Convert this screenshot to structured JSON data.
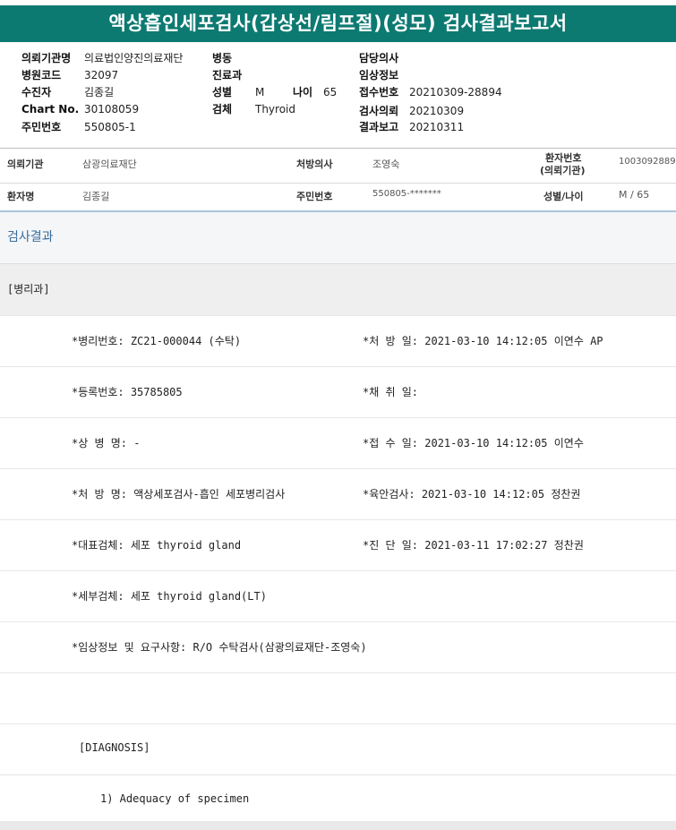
{
  "title": "액상흡인세포검사(갑상선/림프절)(성모) 검사결과보고서",
  "info": {
    "col1": [
      {
        "key": "의뢰기관명",
        "value": "의료법인양진의료재단"
      },
      {
        "key": "병원코드",
        "value": "32097"
      },
      {
        "key": "수진자",
        "value": "김종길"
      },
      {
        "key": "Chart No.",
        "value": "30108059"
      },
      {
        "key": "주민번호",
        "value": "550805-1"
      }
    ],
    "col2": [
      {
        "key": "병동",
        "value": ""
      },
      {
        "key": "진료과",
        "value": ""
      },
      {
        "key": "성별",
        "value": "M"
      },
      {
        "key": "검체",
        "value": "Thyroid"
      }
    ],
    "age": {
      "key": "나이",
      "value": "65"
    },
    "col3": [
      {
        "key": "담당의사",
        "value": ""
      },
      {
        "key": "임상정보",
        "value": ""
      },
      {
        "key": "접수번호",
        "value": "20210309-28894"
      },
      {
        "key": "검사의뢰",
        "value": "20210309"
      },
      {
        "key": "결과보고",
        "value": "20210311"
      }
    ]
  },
  "header": {
    "row1": {
      "institution_label": "의뢰기관",
      "institution_value": "삼광의료재단",
      "doctor_label": "처방의사",
      "doctor_value": "조영숙",
      "patient_no_label_1": "환자번호",
      "patient_no_label_2": "(의뢰기관)",
      "patient_no_value": "1003092889"
    },
    "row2": {
      "patient_label": "환자명",
      "patient_value": "김종길",
      "rrn_label": "주민번호",
      "rrn_value": "550805-*******",
      "sexage_label": "성별/나이",
      "sexage_value": "M / 65"
    }
  },
  "results": {
    "section_title": "검사결과",
    "department": "[병리과]",
    "rows": [
      {
        "left": "*병리번호: ZC21-000044 (수탁)",
        "right": "*처 방 일: 2021-03-10 14:12:05  이연수 AP"
      },
      {
        "left": "*등록번호: 35785805",
        "right": "*채 취 일:"
      },
      {
        "left": "*상 병 명: -",
        "right": "*접 수 일: 2021-03-10 14:12:05  이연수"
      },
      {
        "left": "*처 방 명: 액상세포검사-흡인 세포병리검사",
        "right": "*육안검사: 2021-03-10 14:12:05  정찬권"
      },
      {
        "left": "*대표검체: 세포 thyroid gland",
        "right": "*진 단 일: 2021-03-11 17:02:27  정찬권"
      },
      {
        "left": "*세부검체: 세포 thyroid gland(LT)",
        "right": ""
      },
      {
        "left": "*임상정보 및 요구사항: R/O 수탁검사(삼광의료재단-조영숙)",
        "right": ""
      },
      {
        "left": "",
        "right": ""
      }
    ],
    "diagnosis_label": "[DIAGNOSIS]",
    "adequacy": "1) Adequacy of specimen"
  }
}
